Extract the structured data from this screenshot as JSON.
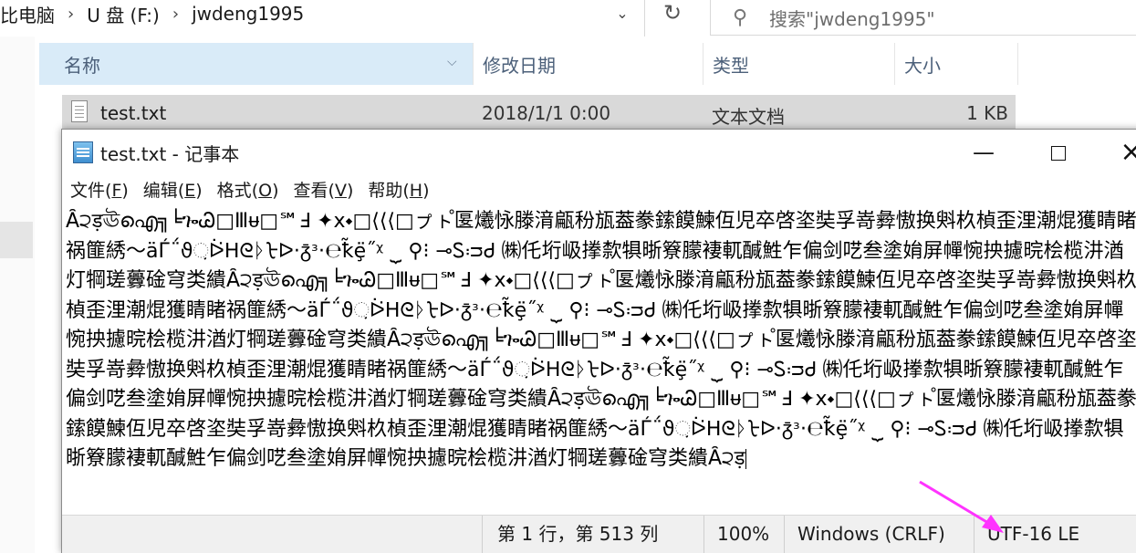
{
  "explorer": {
    "breadcrumb": [
      "比电脑",
      "U 盘 (F:)",
      "jwdeng1995"
    ],
    "breadcrumb_separator": "›",
    "search_placeholder": "搜索\"jwdeng1995\"",
    "columns": {
      "name": "名称",
      "date": "修改日期",
      "type": "类型",
      "size": "大小"
    },
    "files": [
      {
        "name": "test.txt",
        "date": "2018/1/1 0:00",
        "type": "文本文档",
        "size": "1 KB"
      }
    ],
    "icons": {
      "dropdown": "chevron-down-icon",
      "refresh": "refresh-icon",
      "search": "search-icon",
      "file": "text-file-icon"
    }
  },
  "notepad": {
    "title": "test.txt - 记事本",
    "menu": [
      {
        "label": "文件",
        "key": "F"
      },
      {
        "label": "编辑",
        "key": "E"
      },
      {
        "label": "格式",
        "key": "O"
      },
      {
        "label": "查看",
        "key": "V"
      },
      {
        "label": "帮助",
        "key": "H"
      }
    ],
    "content": "Ȃ੨ड़ঊഐ╗╘ጐᏊ□Ⅲᵾ□℠Ⅎ ✦ⅹ⬩□⟨⟨⟨□ㇷ゚ㇳ゚匽爔怺滕湇甂秎瓬葢豢鎍饃鰊仾児卒啓垐奘孚嵜彜慠换斞杦楨歪浬潮焜獲睛睹祸篚綉～äЃ΅ϑ઼ᐖᕼᘓᚦᡶᐅ·ᵹ̄ᶟ·℮ꝁ̃ȩ̈˝ᵡ ⏟ ⚲⁝ ⊸ᏚᴞᏧ ㈱仛垳岋搼歀犋晣簝朦褄軏醎鮏乍偏剑呓叁塗姢屏幝惋抰攄晥桧榄汫湭灯犅瑳虋碒穹类繢Ȃ੨ड़ঊഐ╗╘ጐᏊ□Ⅲᵾ□℠Ⅎ ✦ⅹ⬩□⟨⟨⟨□ㇷ゚ㇳ゚匽爔怺滕湇甂秎瓬葢豢鎍饃鰊仾児卒啓垐奘孚嵜彜慠换斞杦楨歪浬潮焜獲睛睹祸篚綉～äЃ΅ϑ઼ᐖᕼᘓᚦᡶᐅ·ᵹ̄ᶟ·℮ꝁ̃ȩ̈˝ᵡ ⏟ ⚲⁝ ⊸ᏚᴞᏧ ㈱仛垳岋搼歀犋晣簝朦褄軏醎鮏乍偏剑呓叁塗姢屏幝惋抰攄晥桧榄汫湭灯犅瑳虋碒穹类繢Ȃ੨ड़ঊഐ╗╘ጐᏊ□Ⅲᵾ□℠Ⅎ ✦ⅹ⬩□⟨⟨⟨□ㇷ゚ㇳ゚匽爔怺滕湇甂秎瓬葢豢鎍饃鰊仾児卒啓垐奘孚嵜彜慠换斞杦楨歪浬潮焜獲睛睹祸篚綉～äЃ΅ϑ઼ᐖᕼᘓᚦᡶᐅ·ᵹ̄ᶟ·℮ꝁ̃ȩ̈˝ᵡ ⏟ ⚲⁝ ⊸ᏚᴞᏧ ㈱仛垳岋搼歀犋晣簝朦褄軏醎鮏乍偏剑呓叁塗姢屏幝惋抰攄晥桧榄汫湭灯犅瑳虋碒穹类繢Ȃ੨ड़ঊഐ╗╘ጐᏊ□Ⅲᵾ□℠Ⅎ ✦ⅹ⬩□⟨⟨⟨□ㇷ゚ㇳ゚匽爔怺滕湇甂秎瓬葢豢鎍饃鰊仾児卒啓垐奘孚嵜彜慠换斞杦楨歪浬潮焜獲睛睹祸篚綉～äЃ΅ϑ઼ᐖᕼᘓᚦᡶᐅ·ᵹ̄ᶟ·℮ꝁ̃ȩ̈˝ᵡ ⏟ ⚲⁝ ⊸ᏚᴞᏧ ㈱仛垳岋搼歀犋晣簝朦褄軏醎鮏乍偏剑呓叁塗姢屏幝惋抰攄晥桧榄汫湭灯犅瑳虋碒穹类繢Ȃ੨ड़",
    "status": {
      "position": "第 1 行，第 513 列",
      "zoom": "100%",
      "line_ending": "Windows (CRLF)",
      "encoding": "UTF-16 LE"
    },
    "icons": {
      "app": "notepad-icon",
      "minimize": "minimize-icon",
      "maximize": "maximize-icon",
      "close": "close-icon"
    }
  },
  "colors": {
    "header_selected": "#d9ebf8",
    "row_selected": "#d9d9d9",
    "status_bar": "#f0f0f0",
    "annotation_arrow": "#ff33ff"
  }
}
